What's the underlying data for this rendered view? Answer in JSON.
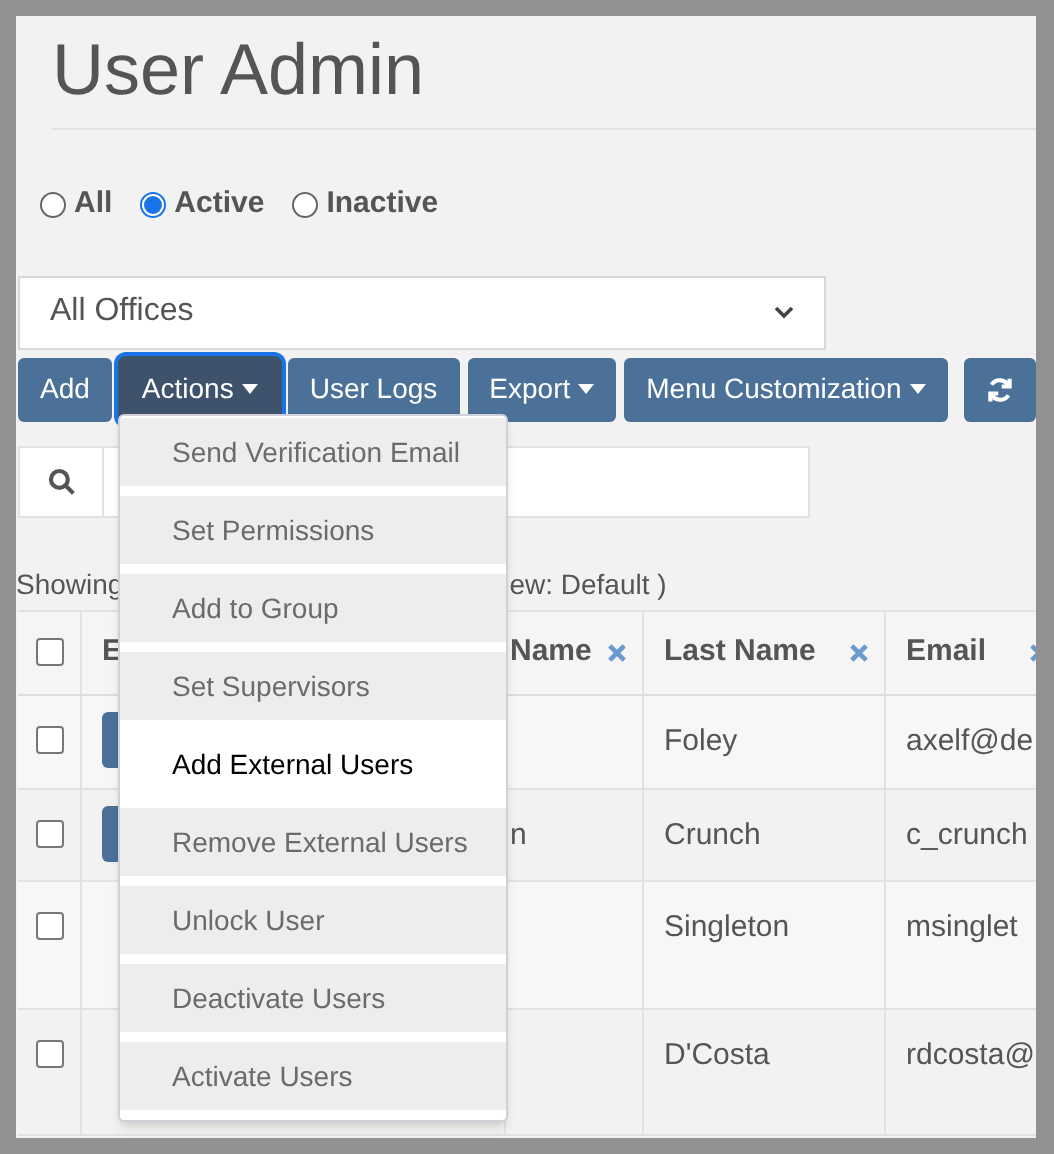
{
  "title": "User Admin",
  "status_filter": [
    {
      "label": "All",
      "selected": false
    },
    {
      "label": "Active",
      "selected": true
    },
    {
      "label": "Inactive",
      "selected": false
    }
  ],
  "office_select": {
    "value": "All Offices"
  },
  "toolbar": [
    {
      "label": "Add",
      "kind": "button",
      "active": false
    },
    {
      "label": "Actions",
      "kind": "dropdown",
      "active": true
    },
    {
      "label": "User Logs",
      "kind": "button",
      "active": false
    },
    {
      "label": "Export",
      "kind": "dropdown",
      "active": false
    },
    {
      "label": "Menu Customization",
      "kind": "dropdown",
      "active": false
    },
    {
      "kind": "refresh",
      "active": false
    }
  ],
  "showing_text": {
    "start": "Showing",
    "end": "ew: Default )"
  },
  "actions_menu": [
    {
      "label": "Send Verification Email",
      "selected": false
    },
    {
      "label": "Set Permissions",
      "selected": false
    },
    {
      "label": "Add to Group",
      "selected": false
    },
    {
      "label": "Set Supervisors",
      "selected": false
    },
    {
      "label": "Add External Users",
      "selected": true
    },
    {
      "label": "Remove External Users",
      "selected": false
    },
    {
      "label": "Unlock User",
      "selected": false
    },
    {
      "label": "Deactivate Users",
      "selected": false
    },
    {
      "label": "Activate Users",
      "selected": false
    }
  ],
  "table": {
    "select_all": {
      "checked": false
    },
    "columns": [
      {
        "label": "E"
      },
      {
        "label": "Name",
        "removable": true
      },
      {
        "label": "Last Name",
        "removable": true
      },
      {
        "label": "Email",
        "removable": true
      }
    ],
    "rows": [
      {
        "checked": false,
        "has_button": true,
        "last_name": "Foley",
        "email": "axelf@de"
      },
      {
        "checked": false,
        "has_button": true,
        "first_name": "n",
        "last_name": "Crunch",
        "email": "c_crunch"
      },
      {
        "checked": false,
        "has_button": false,
        "last_name": "Singleton",
        "email": "msinglet"
      },
      {
        "checked": false,
        "has_button": false,
        "last_name": "D'Costa",
        "email": "rdcosta@"
      }
    ]
  }
}
